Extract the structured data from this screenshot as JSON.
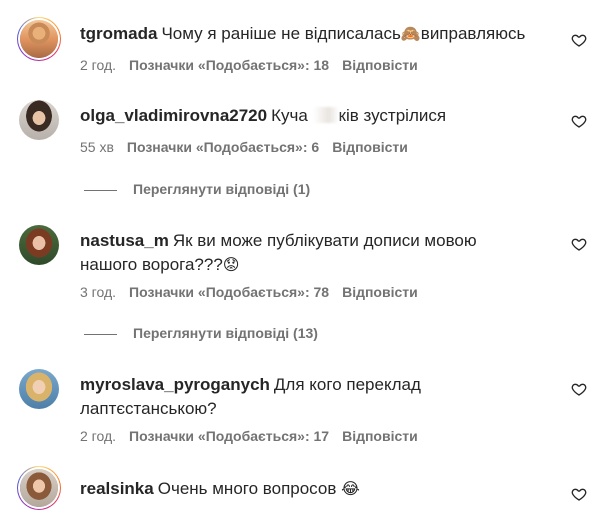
{
  "comments": [
    {
      "username": "tgromada",
      "text_before": "Чому я раніше не відписалась",
      "emoji": "🙈",
      "text_after": "виправляюсь",
      "time": "2 год.",
      "likes": "Позначки «Подобається»: 18",
      "reply": "Відповісти"
    },
    {
      "username": "olga_vladimirovna2720",
      "text_before": "Куча",
      "text_after": "ків зустрілися",
      "time": "55 хв",
      "likes": "Позначки «Подобається»: 6",
      "reply": "Відповісти",
      "view_replies": "Переглянути відповіді (1)"
    },
    {
      "username": "nastusa_m",
      "text_line1": "Як ви може публікувати дописи мовою",
      "text_line2": "нашого ворога???",
      "emoji": "😟",
      "time": "3 год.",
      "likes": "Позначки «Подобається»: 78",
      "reply": "Відповісти",
      "view_replies": "Переглянути відповіді (13)"
    },
    {
      "username": "myroslava_pyroganych",
      "text_line1": "Для кого переклад",
      "text_line2": "лаптєстанською?",
      "time": "2 год.",
      "likes": "Позначки «Подобається»: 17",
      "reply": "Відповісти"
    },
    {
      "username": "realsinka",
      "text_before": "Очень много вопросов",
      "emoji": "😂"
    }
  ],
  "icons": {
    "like": "heart-outline-icon"
  },
  "colors": {
    "text": "#262626",
    "secondary": "#737373",
    "story_ring": [
      "#feda75",
      "#fa7e1e",
      "#d62976",
      "#962fbf",
      "#4f5bd5"
    ]
  }
}
